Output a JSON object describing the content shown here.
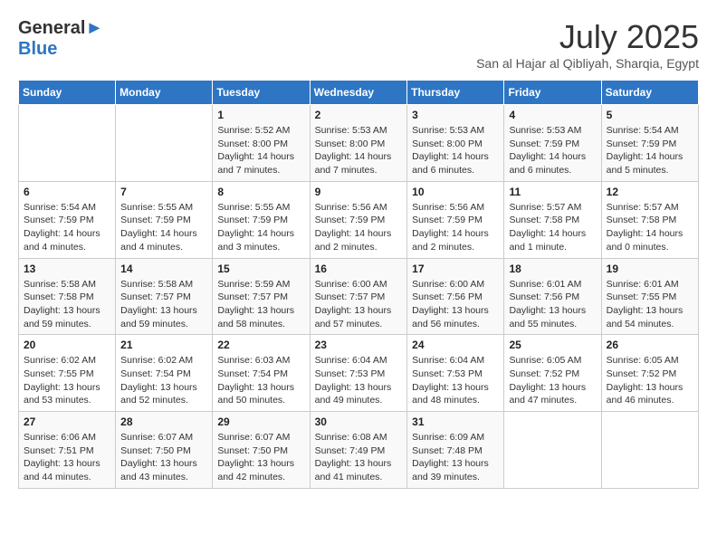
{
  "header": {
    "logo_line1": "General",
    "logo_line2": "Blue",
    "month_year": "July 2025",
    "location": "San al Hajar al Qibliyah, Sharqia, Egypt"
  },
  "days_of_week": [
    "Sunday",
    "Monday",
    "Tuesday",
    "Wednesday",
    "Thursday",
    "Friday",
    "Saturday"
  ],
  "weeks": [
    [
      {
        "day": "",
        "sunrise": "",
        "sunset": "",
        "daylight": ""
      },
      {
        "day": "",
        "sunrise": "",
        "sunset": "",
        "daylight": ""
      },
      {
        "day": "1",
        "sunrise": "Sunrise: 5:52 AM",
        "sunset": "Sunset: 8:00 PM",
        "daylight": "Daylight: 14 hours and 7 minutes."
      },
      {
        "day": "2",
        "sunrise": "Sunrise: 5:53 AM",
        "sunset": "Sunset: 8:00 PM",
        "daylight": "Daylight: 14 hours and 7 minutes."
      },
      {
        "day": "3",
        "sunrise": "Sunrise: 5:53 AM",
        "sunset": "Sunset: 8:00 PM",
        "daylight": "Daylight: 14 hours and 6 minutes."
      },
      {
        "day": "4",
        "sunrise": "Sunrise: 5:53 AM",
        "sunset": "Sunset: 7:59 PM",
        "daylight": "Daylight: 14 hours and 6 minutes."
      },
      {
        "day": "5",
        "sunrise": "Sunrise: 5:54 AM",
        "sunset": "Sunset: 7:59 PM",
        "daylight": "Daylight: 14 hours and 5 minutes."
      }
    ],
    [
      {
        "day": "6",
        "sunrise": "Sunrise: 5:54 AM",
        "sunset": "Sunset: 7:59 PM",
        "daylight": "Daylight: 14 hours and 4 minutes."
      },
      {
        "day": "7",
        "sunrise": "Sunrise: 5:55 AM",
        "sunset": "Sunset: 7:59 PM",
        "daylight": "Daylight: 14 hours and 4 minutes."
      },
      {
        "day": "8",
        "sunrise": "Sunrise: 5:55 AM",
        "sunset": "Sunset: 7:59 PM",
        "daylight": "Daylight: 14 hours and 3 minutes."
      },
      {
        "day": "9",
        "sunrise": "Sunrise: 5:56 AM",
        "sunset": "Sunset: 7:59 PM",
        "daylight": "Daylight: 14 hours and 2 minutes."
      },
      {
        "day": "10",
        "sunrise": "Sunrise: 5:56 AM",
        "sunset": "Sunset: 7:59 PM",
        "daylight": "Daylight: 14 hours and 2 minutes."
      },
      {
        "day": "11",
        "sunrise": "Sunrise: 5:57 AM",
        "sunset": "Sunset: 7:58 PM",
        "daylight": "Daylight: 14 hours and 1 minute."
      },
      {
        "day": "12",
        "sunrise": "Sunrise: 5:57 AM",
        "sunset": "Sunset: 7:58 PM",
        "daylight": "Daylight: 14 hours and 0 minutes."
      }
    ],
    [
      {
        "day": "13",
        "sunrise": "Sunrise: 5:58 AM",
        "sunset": "Sunset: 7:58 PM",
        "daylight": "Daylight: 13 hours and 59 minutes."
      },
      {
        "day": "14",
        "sunrise": "Sunrise: 5:58 AM",
        "sunset": "Sunset: 7:57 PM",
        "daylight": "Daylight: 13 hours and 59 minutes."
      },
      {
        "day": "15",
        "sunrise": "Sunrise: 5:59 AM",
        "sunset": "Sunset: 7:57 PM",
        "daylight": "Daylight: 13 hours and 58 minutes."
      },
      {
        "day": "16",
        "sunrise": "Sunrise: 6:00 AM",
        "sunset": "Sunset: 7:57 PM",
        "daylight": "Daylight: 13 hours and 57 minutes."
      },
      {
        "day": "17",
        "sunrise": "Sunrise: 6:00 AM",
        "sunset": "Sunset: 7:56 PM",
        "daylight": "Daylight: 13 hours and 56 minutes."
      },
      {
        "day": "18",
        "sunrise": "Sunrise: 6:01 AM",
        "sunset": "Sunset: 7:56 PM",
        "daylight": "Daylight: 13 hours and 55 minutes."
      },
      {
        "day": "19",
        "sunrise": "Sunrise: 6:01 AM",
        "sunset": "Sunset: 7:55 PM",
        "daylight": "Daylight: 13 hours and 54 minutes."
      }
    ],
    [
      {
        "day": "20",
        "sunrise": "Sunrise: 6:02 AM",
        "sunset": "Sunset: 7:55 PM",
        "daylight": "Daylight: 13 hours and 53 minutes."
      },
      {
        "day": "21",
        "sunrise": "Sunrise: 6:02 AM",
        "sunset": "Sunset: 7:54 PM",
        "daylight": "Daylight: 13 hours and 52 minutes."
      },
      {
        "day": "22",
        "sunrise": "Sunrise: 6:03 AM",
        "sunset": "Sunset: 7:54 PM",
        "daylight": "Daylight: 13 hours and 50 minutes."
      },
      {
        "day": "23",
        "sunrise": "Sunrise: 6:04 AM",
        "sunset": "Sunset: 7:53 PM",
        "daylight": "Daylight: 13 hours and 49 minutes."
      },
      {
        "day": "24",
        "sunrise": "Sunrise: 6:04 AM",
        "sunset": "Sunset: 7:53 PM",
        "daylight": "Daylight: 13 hours and 48 minutes."
      },
      {
        "day": "25",
        "sunrise": "Sunrise: 6:05 AM",
        "sunset": "Sunset: 7:52 PM",
        "daylight": "Daylight: 13 hours and 47 minutes."
      },
      {
        "day": "26",
        "sunrise": "Sunrise: 6:05 AM",
        "sunset": "Sunset: 7:52 PM",
        "daylight": "Daylight: 13 hours and 46 minutes."
      }
    ],
    [
      {
        "day": "27",
        "sunrise": "Sunrise: 6:06 AM",
        "sunset": "Sunset: 7:51 PM",
        "daylight": "Daylight: 13 hours and 44 minutes."
      },
      {
        "day": "28",
        "sunrise": "Sunrise: 6:07 AM",
        "sunset": "Sunset: 7:50 PM",
        "daylight": "Daylight: 13 hours and 43 minutes."
      },
      {
        "day": "29",
        "sunrise": "Sunrise: 6:07 AM",
        "sunset": "Sunset: 7:50 PM",
        "daylight": "Daylight: 13 hours and 42 minutes."
      },
      {
        "day": "30",
        "sunrise": "Sunrise: 6:08 AM",
        "sunset": "Sunset: 7:49 PM",
        "daylight": "Daylight: 13 hours and 41 minutes."
      },
      {
        "day": "31",
        "sunrise": "Sunrise: 6:09 AM",
        "sunset": "Sunset: 7:48 PM",
        "daylight": "Daylight: 13 hours and 39 minutes."
      },
      {
        "day": "",
        "sunrise": "",
        "sunset": "",
        "daylight": ""
      },
      {
        "day": "",
        "sunrise": "",
        "sunset": "",
        "daylight": ""
      }
    ]
  ]
}
